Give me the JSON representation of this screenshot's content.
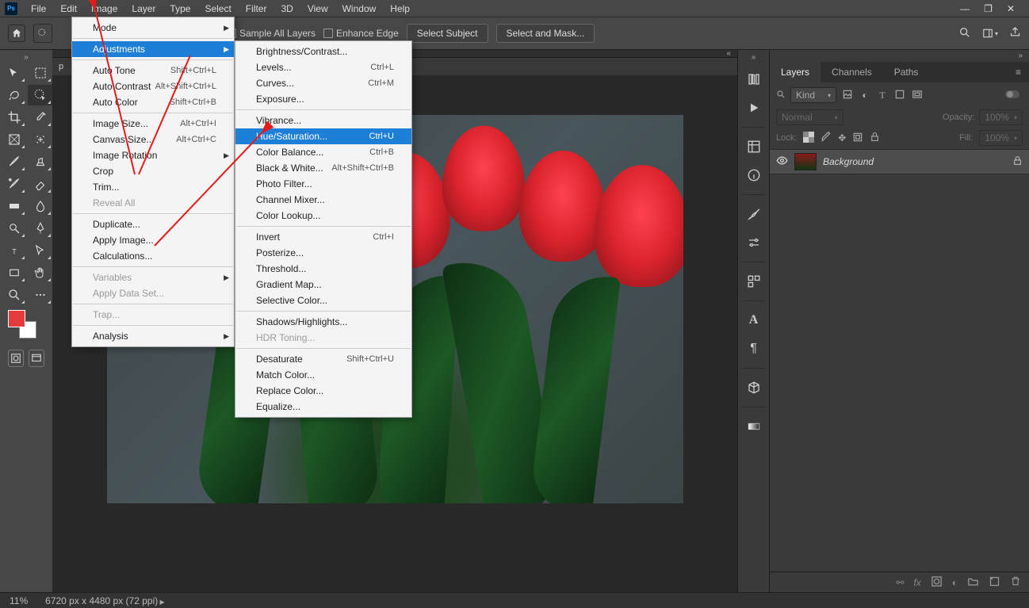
{
  "menubar": [
    "File",
    "Edit",
    "Image",
    "Layer",
    "Type",
    "Select",
    "Filter",
    "3D",
    "View",
    "Window",
    "Help"
  ],
  "options": {
    "sample_all": "Sample All Layers",
    "enhance_edge": "Enhance Edge",
    "select_subject": "Select Subject",
    "select_and_mask": "Select and Mask..."
  },
  "doc_tab": "p",
  "image_menu": [
    {
      "label": "Mode",
      "sub": true
    },
    {
      "sep": true
    },
    {
      "label": "Adjustments",
      "sub": true,
      "hl": true
    },
    {
      "sep": true
    },
    {
      "label": "Auto Tone",
      "shortcut": "Shift+Ctrl+L"
    },
    {
      "label": "Auto Contrast",
      "shortcut": "Alt+Shift+Ctrl+L"
    },
    {
      "label": "Auto Color",
      "shortcut": "Shift+Ctrl+B"
    },
    {
      "sep": true
    },
    {
      "label": "Image Size...",
      "shortcut": "Alt+Ctrl+I"
    },
    {
      "label": "Canvas Size...",
      "shortcut": "Alt+Ctrl+C"
    },
    {
      "label": "Image Rotation",
      "sub": true
    },
    {
      "label": "Crop"
    },
    {
      "label": "Trim..."
    },
    {
      "label": "Reveal All",
      "disabled": true
    },
    {
      "sep": true
    },
    {
      "label": "Duplicate..."
    },
    {
      "label": "Apply Image..."
    },
    {
      "label": "Calculations..."
    },
    {
      "sep": true
    },
    {
      "label": "Variables",
      "sub": true,
      "disabled": true
    },
    {
      "label": "Apply Data Set...",
      "disabled": true
    },
    {
      "sep": true
    },
    {
      "label": "Trap...",
      "disabled": true
    },
    {
      "sep": true
    },
    {
      "label": "Analysis",
      "sub": true
    }
  ],
  "adjustments_menu": [
    {
      "label": "Brightness/Contrast..."
    },
    {
      "label": "Levels...",
      "shortcut": "Ctrl+L"
    },
    {
      "label": "Curves...",
      "shortcut": "Ctrl+M"
    },
    {
      "label": "Exposure..."
    },
    {
      "sep": true
    },
    {
      "label": "Vibrance..."
    },
    {
      "label": "Hue/Saturation...",
      "shortcut": "Ctrl+U",
      "hl": true
    },
    {
      "label": "Color Balance...",
      "shortcut": "Ctrl+B"
    },
    {
      "label": "Black & White...",
      "shortcut": "Alt+Shift+Ctrl+B"
    },
    {
      "label": "Photo Filter..."
    },
    {
      "label": "Channel Mixer..."
    },
    {
      "label": "Color Lookup..."
    },
    {
      "sep": true
    },
    {
      "label": "Invert",
      "shortcut": "Ctrl+I"
    },
    {
      "label": "Posterize..."
    },
    {
      "label": "Threshold..."
    },
    {
      "label": "Gradient Map..."
    },
    {
      "label": "Selective Color..."
    },
    {
      "sep": true
    },
    {
      "label": "Shadows/Highlights..."
    },
    {
      "label": "HDR Toning...",
      "disabled": true
    },
    {
      "sep": true
    },
    {
      "label": "Desaturate",
      "shortcut": "Shift+Ctrl+U"
    },
    {
      "label": "Match Color..."
    },
    {
      "label": "Replace Color..."
    },
    {
      "label": "Equalize..."
    }
  ],
  "layers_panel": {
    "tabs": [
      "Layers",
      "Channels",
      "Paths"
    ],
    "kind_label": "Kind",
    "blend": "Normal",
    "opacity_label": "Opacity:",
    "opacity_value": "100%",
    "lock_label": "Lock:",
    "fill_label": "Fill:",
    "fill_value": "100%",
    "layer_name": "Background"
  },
  "status": {
    "zoom": "11%",
    "dims": "6720 px x 4480 px (72 ppi)"
  },
  "ps_badge": "Ps",
  "search_placeholder": "Kind"
}
